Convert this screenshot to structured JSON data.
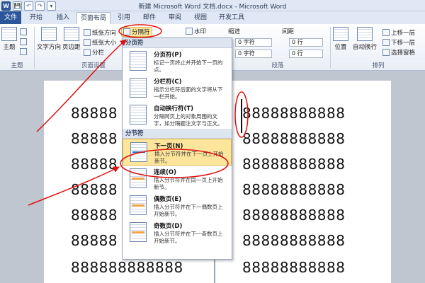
{
  "window": {
    "title": "新建 Microsoft Word 文档.docx - Microsoft Word"
  },
  "quick_access": [
    "W",
    "💾",
    "↶",
    "↷",
    "▾"
  ],
  "tabs": [
    "文件",
    "开始",
    "插入",
    "页面布局",
    "引用",
    "邮件",
    "审阅",
    "视图",
    "开发工具"
  ],
  "ribbon": {
    "themes_label": "主题",
    "themes_group": "主题",
    "text_direction": "文字方向",
    "margins": "页边距",
    "orientation": "纸张方向",
    "size": "纸张大小",
    "columns": "分栏",
    "breaks": "分隔符",
    "page_setup_group": "页面设置",
    "watermark": "水印",
    "indent_label": "缩进",
    "spacing_label": "间距",
    "indent_left": "0 字符",
    "indent_right": "0 字符",
    "spacing_before": "0 行",
    "spacing_after": "0 行",
    "paragraph_group": "段落",
    "position": "位置",
    "wrap_text": "自动换行",
    "bring_forward": "上移一层",
    "send_backward": "下移一层",
    "selection_pane": "选择窗格",
    "arrange_group": "排列"
  },
  "menu": {
    "page_breaks_header": "分页符",
    "section_breaks_header": "分节符",
    "items": [
      {
        "title": "分页符(P)",
        "desc": "标记一页终止并开始下一页的\n点。"
      },
      {
        "title": "分栏符(C)",
        "desc": "指示分栏符后面的文字将从下\n一栏开始。"
      },
      {
        "title": "自动换行符(T)",
        "desc": "分隔网页上的对象周围的文\n字，如分隔题注文字与正文。"
      },
      {
        "title": "下一页(N)",
        "desc": "插入分节符并在下一页上开始\n新节。"
      },
      {
        "title": "连续(O)",
        "desc": "插入分节符并在同一页上开始\n新节。"
      },
      {
        "title": "偶数页(E)",
        "desc": "插入分节符并在下一偶数页上\n开始新节。"
      },
      {
        "title": "奇数页(D)",
        "desc": "插入分节符并在下一奇数页上\n开始新节。"
      }
    ]
  },
  "document": {
    "left_lines": [
      "88888",
      "88888",
      "88888",
      "88888",
      "88888",
      "88888",
      "888888888888"
    ],
    "right_lines": [
      "88888888888",
      "88888888888",
      "88888888888",
      "88888888888",
      "88888888888",
      "88888888888",
      "88888888888"
    ]
  },
  "colors": {
    "accent": "#2b579a",
    "annotation": "#e01010",
    "menu_highlight": "#fde69c"
  }
}
